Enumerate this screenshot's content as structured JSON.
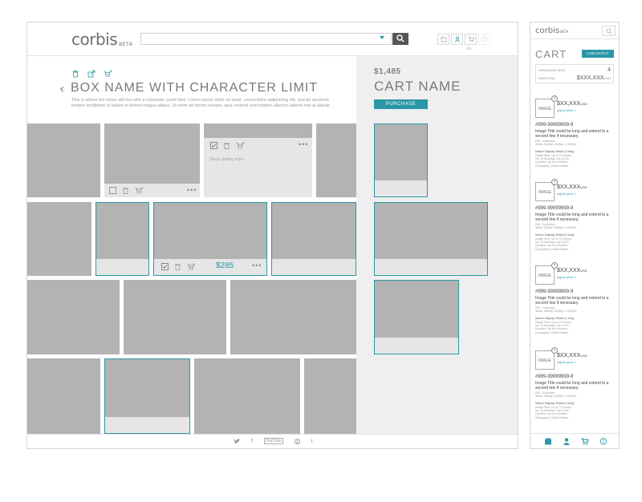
{
  "header": {
    "logo": "corbis",
    "logo_badge": "BETA",
    "search": {
      "value": "",
      "placeholder": ""
    }
  },
  "box": {
    "title": "BOX NAME WITH CHARACTER LIMIT",
    "notes": "This is where the notes will live with a character count limit. Lorem ipsum dolor sit amet, consectetur adipisicing elit, sed do eiusmod tempor incididunt ut labore et dolore magna aliqua. Ut enim ad minim veniam, quis nostrud exercitation ullamco laboris nisi ut aliquip.",
    "note_editing_placeholder": "Begin adding notes",
    "tile_price": "$285",
    "more_label": "•••"
  },
  "cart": {
    "total": "$1,485",
    "name": "CART NAME",
    "purchase_label": "PURCHASE"
  },
  "footer": {
    "social": [
      "twitter",
      "f",
      "You Tube",
      "pinterest",
      "t"
    ],
    "social_text": [
      "",
      "f",
      "YouTube",
      "",
      "t"
    ]
  },
  "mobile": {
    "logo": "corbis",
    "logo_badge": "BETA",
    "cart_title": "CART",
    "checkout_label": "CHECKOUT",
    "purchase_now_label": "PURCHASE NOW",
    "purchase_now_value": "4",
    "subtotal_label": "SUBTOTAL",
    "subtotal_value": "$XXX,XXX",
    "subtotal_currency": "USD",
    "items": [
      {
        "image_label": "IMAGE",
        "price": "$XX,XXX",
        "currency": "USD",
        "adjust": "adjust price »",
        "id": "#999-99999999-9",
        "desc": "Image Title could be long and extend to a second line if necessary.",
        "meta": [
          "RM - Collection",
          "48mb, 300dpi, 3328px × 4992px"
        ],
        "license_head": "Indoor Display Small (1 only)",
        "license": [
          "Image Size: Up to 72 inches",
          "No. of Displays: Up to 100",
          "Duration: Up to 6 months",
          "Geography: United States"
        ]
      },
      {
        "image_label": "IMAGE",
        "price": "$XX,XXX",
        "currency": "USD",
        "adjust": "adjust price »",
        "id": "#999-99999999-9",
        "desc": "Image Title could be long and extend to a second line if necessary.",
        "meta": [
          "RM - Collection",
          "48mb, 300dpi, 3328px × 4992px"
        ],
        "license_head": "Indoor Display Small (1 only)",
        "license": [
          "Image Size: Up to 72 inches",
          "No. of Displays: Up to 100",
          "Duration: Up to 6 months",
          "Geography: United States"
        ]
      },
      {
        "image_label": "IMAGE",
        "price": "$XX,XXX",
        "currency": "USD",
        "adjust": "adjust price »",
        "id": "#999-99999999-9",
        "desc": "Image Title could be long and extend to a second line if necessary.",
        "meta": [
          "RM - Collection",
          "48mb, 300dpi, 3328px × 4992px"
        ],
        "license_head": "Indoor Display Small (1 only)",
        "license": [
          "Image Size: Up to 72 inches",
          "No. of Displays: Up to 100",
          "Duration: Up to 6 months",
          "Geography: United States"
        ]
      },
      {
        "image_label": "IMAGE",
        "price": "$XX,XXX",
        "currency": "USD",
        "adjust": "adjust price »",
        "id": "#999-99999999-9",
        "desc": "Image Title could be long and extend to a second line if necessary.",
        "meta": [
          "RM - Collection",
          "48mb, 300dpi, 3328px × 4992px"
        ],
        "license_head": "Indoor Display Small (1 only)",
        "license": [
          "Image Size: Up to 72 inches",
          "No. of Displays: Up to 100",
          "Duration: Up to 6 months",
          "Geography: United States"
        ]
      }
    ]
  },
  "colors": {
    "accent": "#2a97a6",
    "placeholder_gray": "#b3b3b3",
    "panel_gray": "#efefef"
  }
}
